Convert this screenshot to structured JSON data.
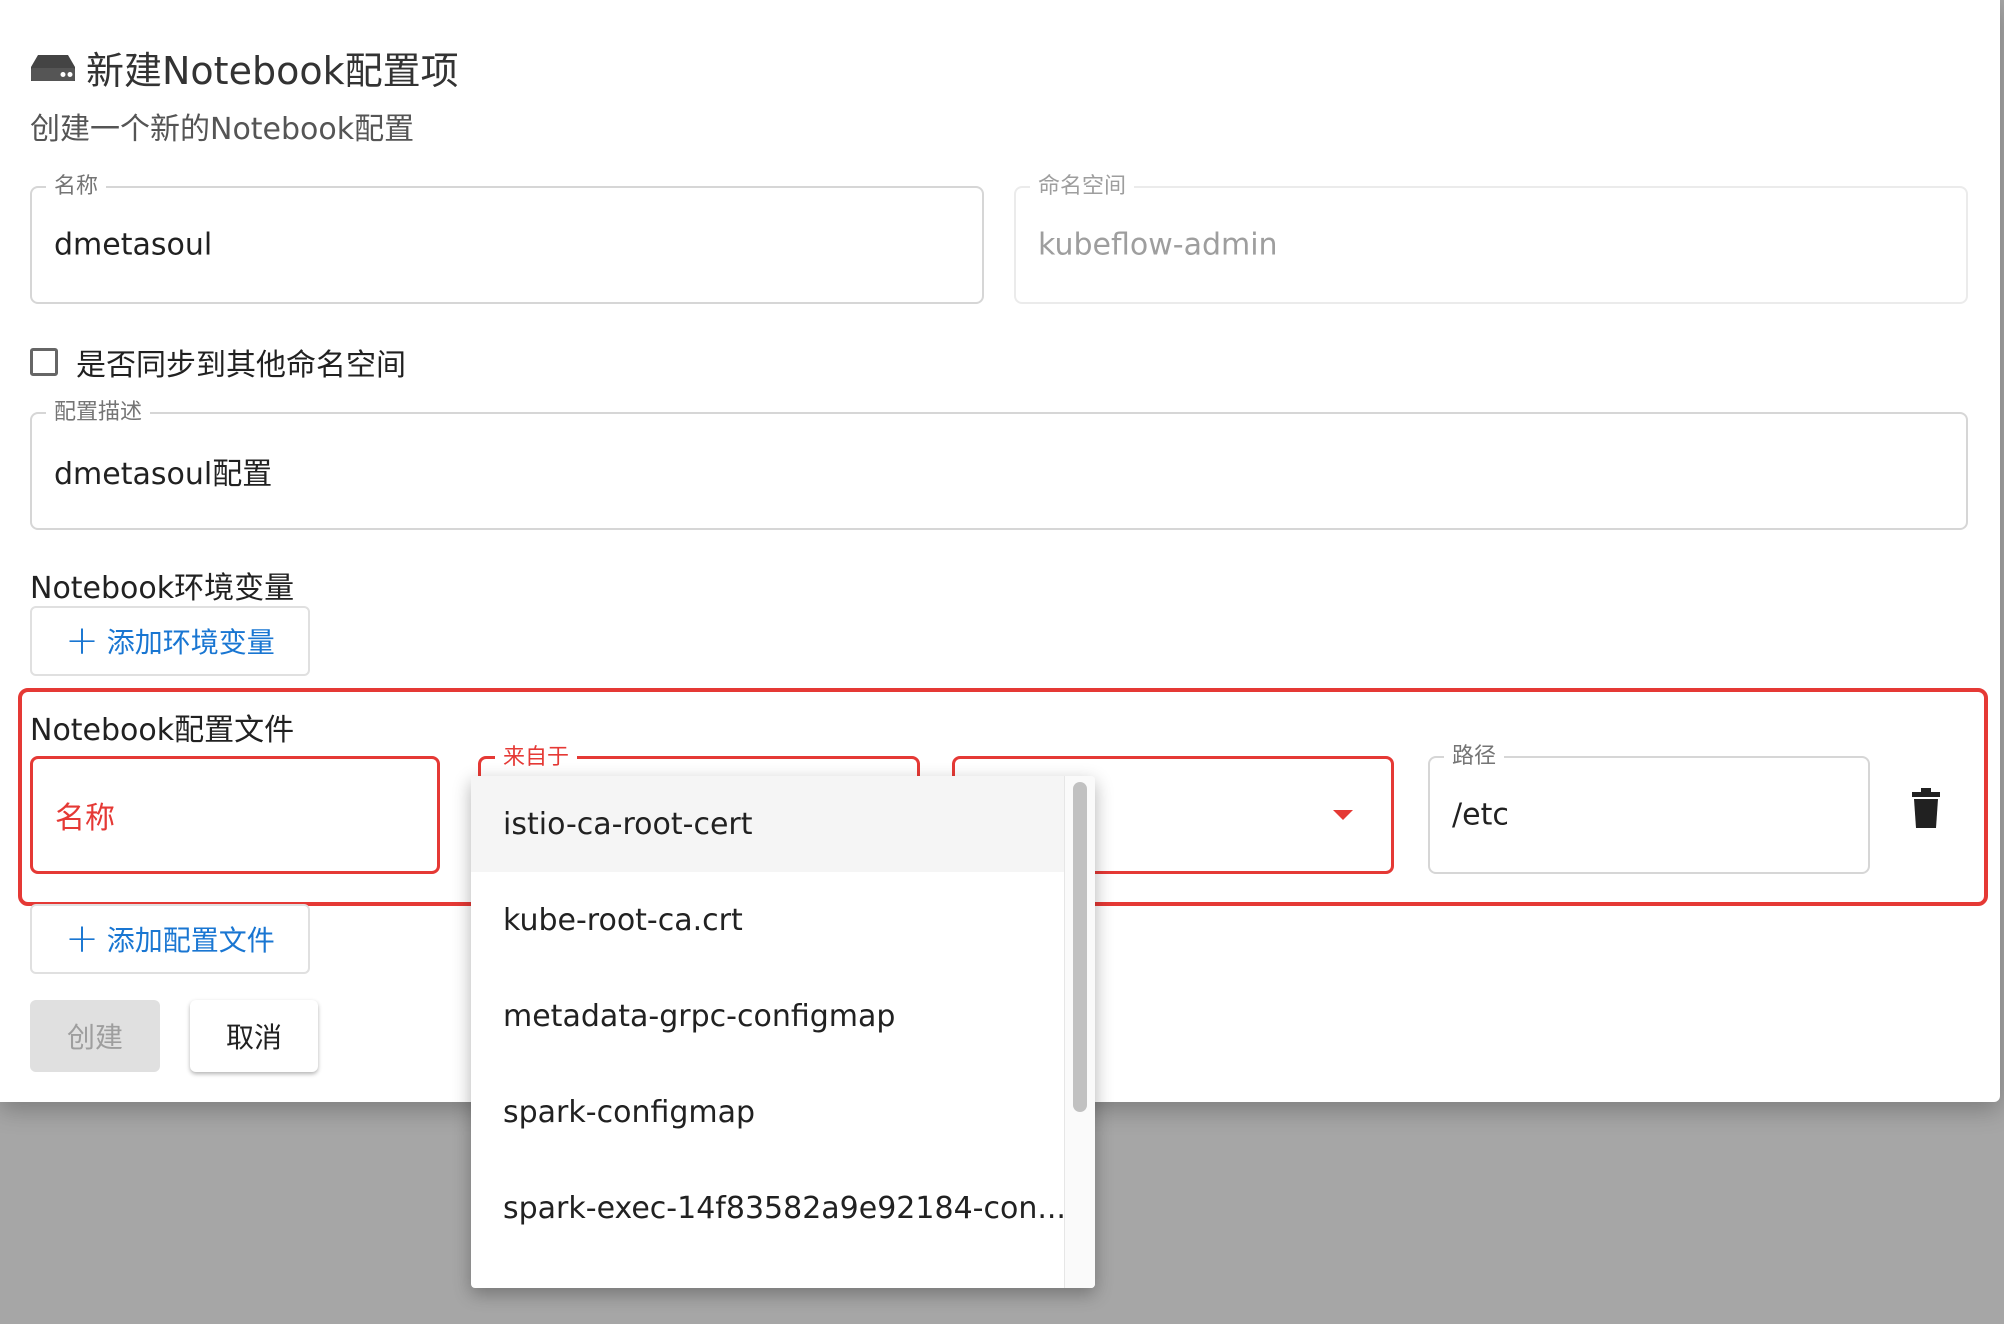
{
  "dialog": {
    "title": "新建Notebook配置项",
    "subtitle": "创建一个新的Notebook配置"
  },
  "form": {
    "name_label": "名称",
    "name_value": "dmetasoul",
    "namespace_label": "命名空间",
    "namespace_value": "kubeflow-admin",
    "sync_label": "是否同步到其他命名空间",
    "desc_label": "配置描述",
    "desc_value": "dmetasoul配置"
  },
  "env_section": {
    "title": "Notebook环境变量",
    "add_button": "添加环境变量"
  },
  "config_section": {
    "title": "Notebook配置文件",
    "name_placeholder": "名称",
    "source_label": "来自于",
    "path_label": "路径",
    "path_value": "/etc",
    "add_button": "添加配置文件"
  },
  "actions": {
    "create": "创建",
    "cancel": "取消"
  },
  "dropdown": {
    "options": [
      "istio-ca-root-cert",
      "kube-root-ca.crt",
      "metadata-grpc-configmap",
      "spark-configmap",
      "spark-exec-14f83582a9e92184-con..."
    ]
  },
  "colors": {
    "accent": "#1976d2",
    "error": "#e53935",
    "overlay": "#a6a6a6"
  }
}
